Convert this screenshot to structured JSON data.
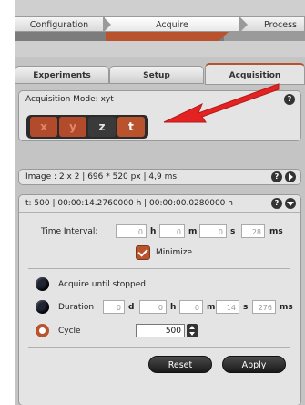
{
  "workflow_tabs": [
    "Configuration",
    "Acquire",
    "Process"
  ],
  "sub_tabs": [
    "Experiments",
    "Setup",
    "Acquisition"
  ],
  "acquisition_mode": {
    "label": "Acquisition Mode: xyt",
    "buttons": [
      "x",
      "y",
      "z",
      "t"
    ]
  },
  "image_info": "Image :   2 x 2 | 696 * 520 px | 4,9 ms",
  "time_series": {
    "header": "t:   500  |   00:00:14.2760000 h  |  00:00:00.0280000 h",
    "time_interval_label": "Time Interval:",
    "interval": {
      "h": "0",
      "m": "0",
      "s": "0",
      "ms": "28"
    },
    "units": {
      "h": "h",
      "m": "m",
      "s": "s",
      "ms": "ms",
      "d": "d"
    },
    "minimize_label": "Minimize",
    "acquire_until_stopped_label": "Acquire until stopped",
    "duration_label": "Duration",
    "duration": {
      "d": "0",
      "h": "0",
      "m": "0",
      "s": "14",
      "ms": "276"
    },
    "cycle_label": "Cycle",
    "cycle_value": "500",
    "reset_label": "Reset",
    "apply_label": "Apply"
  },
  "colors": {
    "accent": "#b8532e",
    "panel": "#e4e4e4",
    "annotation_arrow": "#e52222"
  }
}
